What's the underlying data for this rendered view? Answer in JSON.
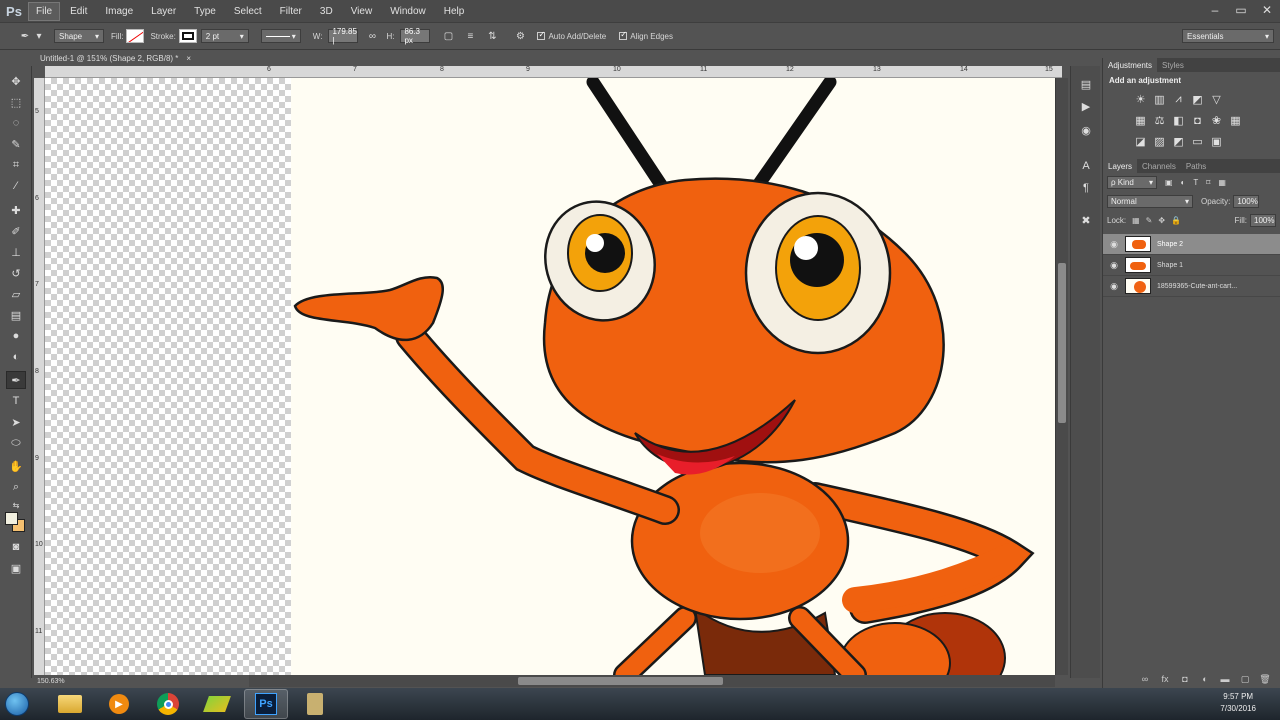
{
  "app": {
    "logo": "Ps"
  },
  "menu": [
    "File",
    "Edit",
    "Image",
    "Layer",
    "Type",
    "Select",
    "Filter",
    "3D",
    "View",
    "Window",
    "Help"
  ],
  "window_controls": [
    "–",
    "▭",
    "✕"
  ],
  "options": {
    "mode": "Shape",
    "fill_label": "Fill:",
    "stroke_label": "Stroke:",
    "stroke_size": "2 pt",
    "w_label": "W:",
    "w_value": "179.85 |",
    "h_label": "H:",
    "h_value": "86.3 px",
    "auto_add": "Auto Add/Delete",
    "align_edges": "Align Edges",
    "workspace": "Essentials"
  },
  "document": {
    "tab_title": "Untitled-1 @ 151% (Shape 2, RGB/8) *",
    "close": "×",
    "zoom": "150.63%"
  },
  "ruler": {
    "top": [
      "6",
      "7",
      "8",
      "9",
      "10",
      "11",
      "12",
      "13",
      "14",
      "15"
    ],
    "left": [
      "5",
      "6",
      "7",
      "8",
      "9",
      "10",
      "11"
    ]
  },
  "panels": {
    "adjustments_tab": "Adjustments",
    "styles_tab": "Styles",
    "adjust_title": "Add an adjustment",
    "layers_tab": "Layers",
    "channels_tab": "Channels",
    "paths_tab": "Paths",
    "kind": "ρ Kind",
    "blend_mode": "Normal",
    "opacity_label": "Opacity:",
    "opacity_value": "100%",
    "lock_label": "Lock:",
    "fill_label": "Fill:",
    "fill_value": "100%",
    "layers": [
      {
        "name": "Shape 2",
        "selected": true
      },
      {
        "name": "Shape 1",
        "selected": false
      },
      {
        "name": "18599365-Cute-ant-cart...",
        "selected": false
      }
    ]
  },
  "taskbar": {
    "time": "9:57 PM",
    "date": "7/30/2016"
  },
  "colors": {
    "ant_orange": "#f0610f",
    "ant_dark": "#c3460a",
    "eye_iris": "#f3a20a",
    "mouth": "#b01010",
    "ps_bg": "#535353"
  }
}
